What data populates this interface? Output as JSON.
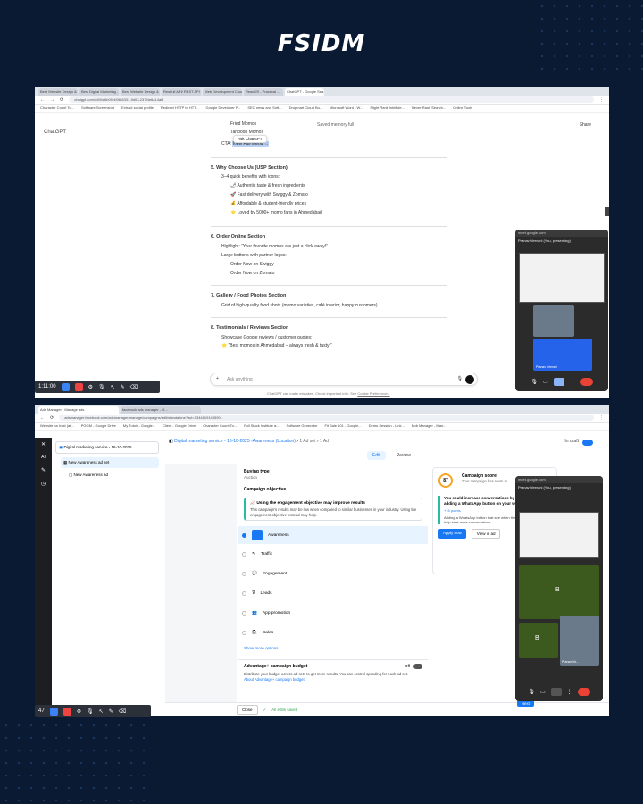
{
  "brand": "FSIDM",
  "top": {
    "tabs": [
      "Best Website Design & ...",
      "Best Digital Marketing ...",
      "Best Website Design & ...",
      "Restfull API/ REST API ...",
      "Web Development Course ...",
      "ReactJS - Practical ...",
      "ChatGPT - Google Sea..."
    ],
    "url": "chatgpt.com/c/6f4a6b09-4f08-8331-9d03-237f4e6a14a8",
    "bookmarks": [
      "Character Count To...",
      "Software Screenshot",
      "Extract social profile",
      "Redirect HTTP to HTT...",
      "Google Developer P...",
      "SEO news and Soft...",
      "Dropmart Cloud Bu...",
      "Microsoft Word - W...",
      "Flight Rank Intellide...",
      "Never Rank Search...",
      "Online Tools"
    ],
    "app": "ChatGPT",
    "share": "Share",
    "memory": "Saved memory full",
    "pre": [
      "Fried Momos",
      "Tandoori Momos"
    ],
    "ask": "Ask ChatGPT",
    "cta_label": "CTA:",
    "cta_link": "View Full Menu →",
    "sec5": {
      "title": "5. Why Choose Us (USP Section)",
      "lead": "3–4 quick benefits with icons:",
      "items": [
        "Authentic taste & fresh ingredients",
        "Fast delivery with Swiggy & Zomato",
        "Affordable & student-friendly prices",
        "Loved by 5000+ momo fans in Ahmedabad"
      ]
    },
    "sec6": {
      "title": "6. Order Online Section",
      "h": "Highlight: “Your favorite momos are just a click away!”",
      "btn": "Large buttons with partner logos:",
      "items": [
        "Order Now on Swiggy",
        "Order Now on Zomato"
      ]
    },
    "sec7": {
      "title": "7. Gallery / Food Photos Section",
      "item": "Grid of high-quality food shots (momo varieties, café interior, happy customers)."
    },
    "sec8": {
      "title": "8. Testimonials / Reviews Section",
      "lead": "Showcase Google reviews / customer quotes:",
      "quote": "“Best momos in Ahmedabad – always fresh & tasty!”"
    },
    "input": "Ask anything",
    "footer": "ChatGPT can make mistakes. Check important info. See",
    "footer_link": "Cookie Preferences.",
    "timer": "1:11:00",
    "meet_url": "meet.google.com",
    "presenter": "Pranav Veerani (You, presenting)",
    "person": "Pranav Veerani"
  },
  "bottom": {
    "tab": "Ads Manager - Manage ads",
    "tab2": "facebook ads manager - G...",
    "url": "adsmanager.facebook.com/adsmanager/manage/campaigns/edit/standalone?act=1344819145590...",
    "bookmarks": [
      "Website on host (at...",
      "PGGM - Google Drive",
      "My Tutoir - Google...",
      "Client - Google Drive",
      "Character Count To...",
      "Full Stack Institute a...",
      "Software Generator",
      "Fit Sale 101 - Google...",
      "Demo Session - Link...",
      "Bob Manager - Man..."
    ],
    "sidebar": {
      "campaign": "Digital marketing service - 16-10-2025...",
      "adset": "New Awareness ad set",
      "ad": "New Awareness ad"
    },
    "crumb": {
      "campaign": "Digital marketing service - 16-10-2025 -Awareness (Location)",
      "adset": "1 Ad set",
      "ad": "1 Ad"
    },
    "draft": "In draft",
    "edit": "Edit",
    "review": "Review",
    "buying_type_label": "Buying type",
    "buying_type": "Auction",
    "objective_label": "Campaign objective",
    "notice_title": "Using the engagement objective may improve results",
    "notice_body": "This campaign's results may be low when compared to similar businesses in your industry. Using the engagement objective instead may help.",
    "objectives": [
      "Awareness",
      "Traffic",
      "Engagement",
      "Leads",
      "App promotion",
      "Sales"
    ],
    "show_more": "Show more options",
    "budget_title": "Advantage+ campaign budget",
    "budget_state": "Off",
    "budget_body": "Distribute your budget across ad sets to get more results. You can control spending for each ad set.",
    "budget_link": "About Advantage+ campaign budget",
    "close": "Close",
    "saved": "All edits saved",
    "score": {
      "value": "87",
      "title": "Campaign score",
      "sub": "Your campaign has room to",
      "rec": "You could increase conversations by 2.5 times by adding a WhatsApp button on your website",
      "points": "+15 points",
      "desc": "Adding a WhatsApp button that see when they open your website help start more conversations.",
      "apply": "Apply now",
      "view": "View in ad"
    },
    "next": "Next",
    "timer": "47",
    "meet_url": "meet.google.com",
    "presenter": "Pranav Veerani (You, presenting)",
    "person": "Pranav Ve...",
    "avatar": "B"
  }
}
